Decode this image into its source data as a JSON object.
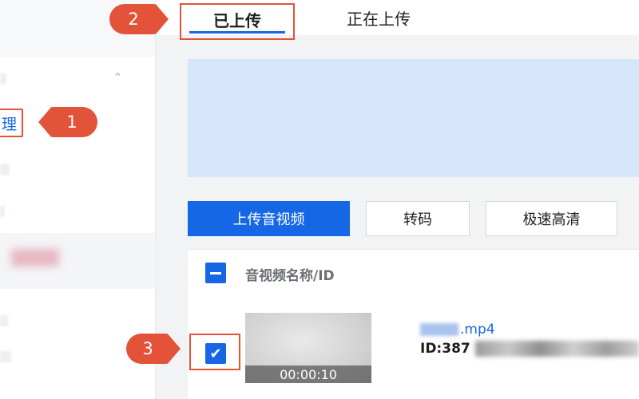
{
  "sidebar": {
    "selected_item_label": "理"
  },
  "callouts": {
    "one": "1",
    "two": "2",
    "three": "3"
  },
  "tabs": [
    {
      "label": "已上传",
      "active": true
    },
    {
      "label": "正在上传",
      "active": false
    }
  ],
  "toolbar": {
    "upload_label": "上传音视频",
    "transcode_label": "转码",
    "hd_label": "极速高清"
  },
  "table": {
    "header_label": "音视频名称/ID",
    "rows": [
      {
        "checked": true,
        "duration": "00:00:10",
        "name_suffix": ".mp4",
        "id_prefix": "ID:387"
      }
    ]
  },
  "colors": {
    "accent": "#1667e6",
    "callout": "#e2533a",
    "banner": "#d6e6fb"
  },
  "icons": {
    "chevron": "chevron-up-icon",
    "check": "checkmark-icon",
    "indeterminate": "minus-icon"
  }
}
